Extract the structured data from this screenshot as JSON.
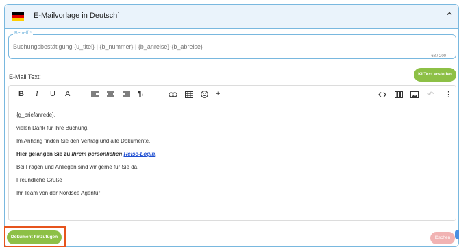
{
  "header": {
    "title": "E-Mailvorlage in Deutsch`",
    "flag_colors": [
      "#000000",
      "#dd0000",
      "#ffce00"
    ]
  },
  "subject": {
    "label": "Betreff *",
    "value": "Buchungsbestätigung {u_titel} | {b_nummer} | {b_anreise}-{b_abreise}",
    "counter": "68 / 200"
  },
  "email": {
    "label": "E-Mail Text:",
    "ki_button": "KI Text erstellen"
  },
  "toolbar": {
    "heading_label": "A"
  },
  "body_lines": {
    "l1": "{g_briefanrede},",
    "l2": "vielen Dank für Ihre Buchung.",
    "l3": "Im Anhang finden Sie den Vertrag und alle Dokumente.",
    "l4_a": "Hier gelangen Sie zu ",
    "l4_b": "Ihrem persönlichen ",
    "l4_link": "Reise-Login",
    "l4_end": ".",
    "l5": "Bei Fragen und Anliegen sind wir gerne für Sie da.",
    "l6": "Freundliche Grüße",
    "l7": "Ihr Team von der Nordsee Agentur"
  },
  "footer": {
    "add_document": "Dokument hinzufügen",
    "delete": "löschen"
  },
  "colors": {
    "accent_green": "#8dc046",
    "border_blue": "#79b8df",
    "highlight_orange": "#e6541d",
    "delete_pink": "#f1b3b3"
  }
}
